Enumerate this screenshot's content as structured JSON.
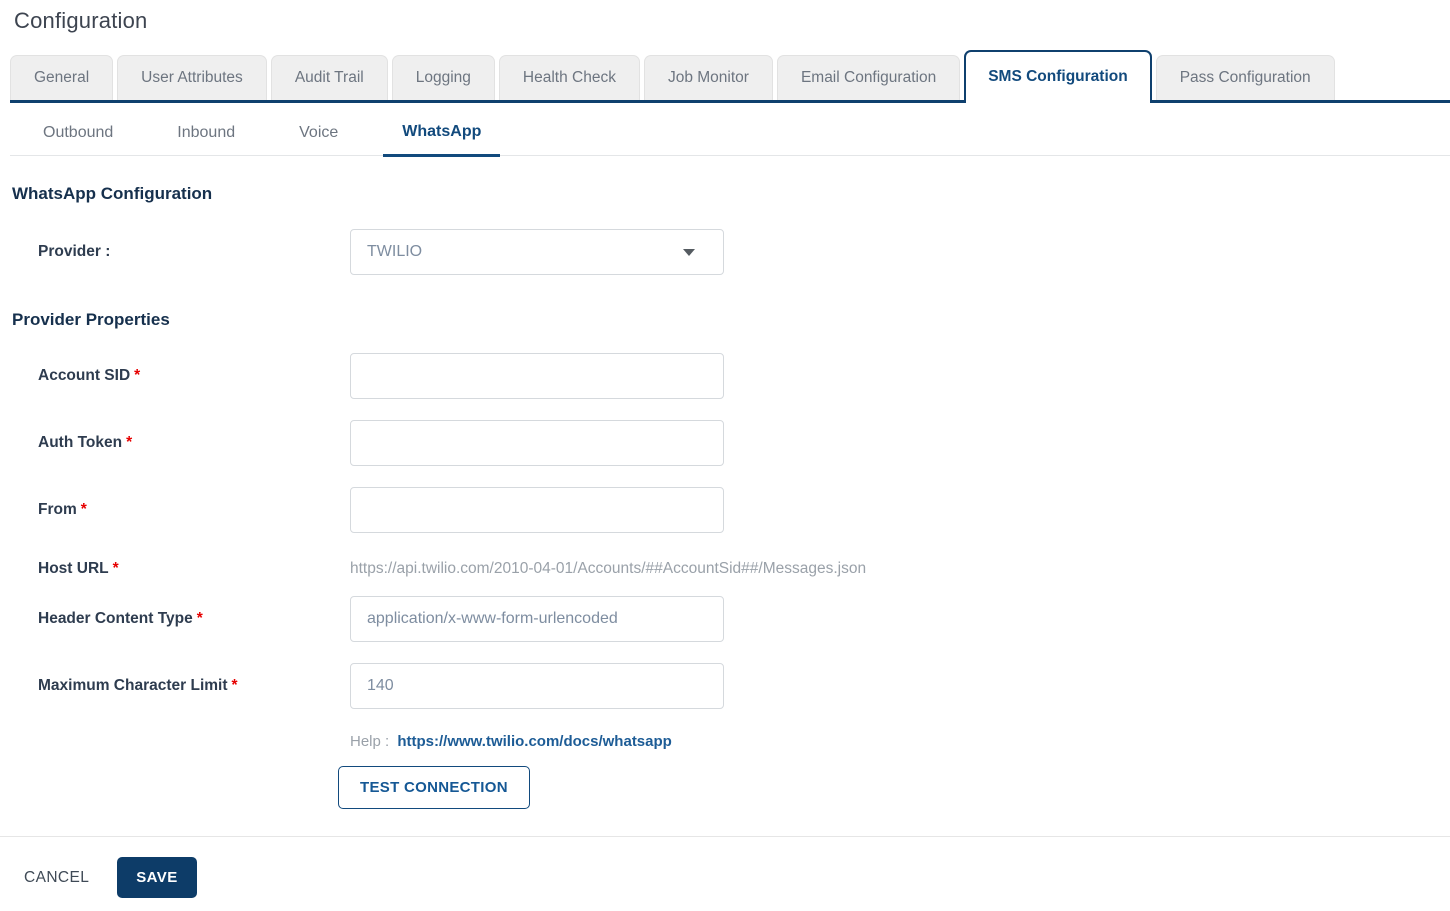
{
  "page": {
    "title": "Configuration"
  },
  "main_tabs": {
    "items": [
      {
        "label": "General",
        "active": false
      },
      {
        "label": "User Attributes",
        "active": false
      },
      {
        "label": "Audit Trail",
        "active": false
      },
      {
        "label": "Logging",
        "active": false
      },
      {
        "label": "Health Check",
        "active": false
      },
      {
        "label": "Job Monitor",
        "active": false
      },
      {
        "label": "Email Configuration",
        "active": false
      },
      {
        "label": "SMS Configuration",
        "active": true
      },
      {
        "label": "Pass Configuration",
        "active": false
      }
    ]
  },
  "sub_tabs": {
    "items": [
      {
        "label": "Outbound",
        "active": false
      },
      {
        "label": "Inbound",
        "active": false
      },
      {
        "label": "Voice",
        "active": false
      },
      {
        "label": "WhatsApp",
        "active": true
      }
    ]
  },
  "whatsapp": {
    "heading": "WhatsApp Configuration",
    "provider_label": "Provider :",
    "provider_value": "TWILIO",
    "caret_icon": "chevron-down-icon"
  },
  "provider_properties": {
    "heading": "Provider Properties",
    "required_mark": "*",
    "fields": [
      {
        "label": "Account SID",
        "required": true,
        "type": "input",
        "value": ""
      },
      {
        "label": "Auth Token",
        "required": true,
        "type": "input",
        "value": ""
      },
      {
        "label": "From",
        "required": true,
        "type": "input",
        "value": ""
      },
      {
        "label": "Host URL",
        "required": true,
        "type": "static",
        "value": "https://api.twilio.com/2010-04-01/Accounts/##AccountSid##/Messages.json"
      },
      {
        "label": "Header Content Type",
        "required": true,
        "type": "input",
        "value": "application/x-www-form-urlencoded"
      },
      {
        "label": "Maximum Character Limit",
        "required": true,
        "type": "input",
        "value": "140"
      }
    ],
    "help_label": "Help :",
    "help_link_text": "https://www.twilio.com/docs/whatsapp",
    "test_button_label": "TEST CONNECTION"
  },
  "footer": {
    "cancel_label": "CANCEL",
    "save_label": "SAVE"
  },
  "colors": {
    "brand_navy": "#124a7d",
    "tab_border_navy": "#0f406e",
    "save_navy": "#0d3c68",
    "link_blue": "#1d5c96",
    "required_red": "#e60000",
    "inactive_tab_bg": "#efefef",
    "inactive_text": "#6d7580",
    "input_text_gray": "#7e8da0"
  }
}
